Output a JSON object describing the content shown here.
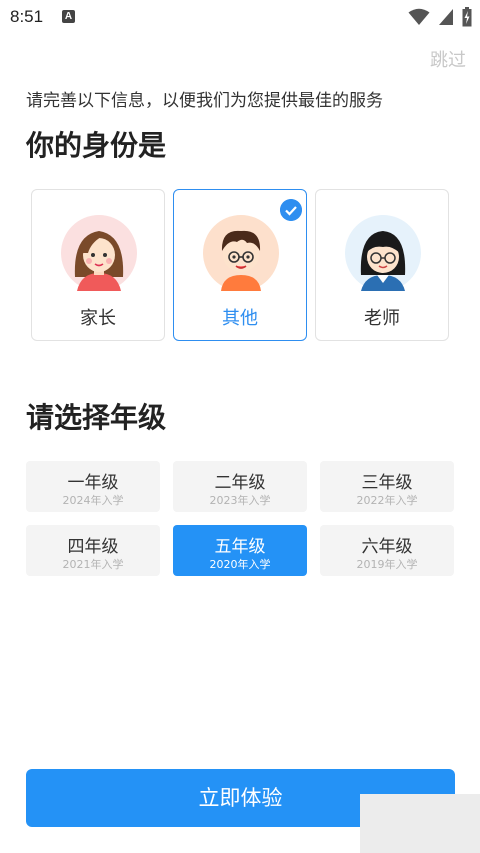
{
  "status_bar": {
    "time": "8:51",
    "notif_letter": "A"
  },
  "header": {
    "skip_label": "跳过"
  },
  "subtitle": "请完善以下信息，以便我们为您提供最佳的服务",
  "identity": {
    "title": "你的身份是",
    "roles": [
      {
        "label": "家长",
        "selected": false
      },
      {
        "label": "其他",
        "selected": true
      },
      {
        "label": "老师",
        "selected": false
      }
    ]
  },
  "grades": {
    "title": "请选择年级",
    "items": [
      {
        "name": "一年级",
        "year": "2024年入学",
        "selected": false
      },
      {
        "name": "二年级",
        "year": "2023年入学",
        "selected": false
      },
      {
        "name": "三年级",
        "year": "2022年入学",
        "selected": false
      },
      {
        "name": "四年级",
        "year": "2021年入学",
        "selected": false
      },
      {
        "name": "五年级",
        "year": "2020年入学",
        "selected": true
      },
      {
        "name": "六年级",
        "year": "2019年入学",
        "selected": false
      }
    ]
  },
  "cta_label": "立即体验",
  "colors": {
    "accent": "#2492f6",
    "selected_border": "#2e8ef0",
    "muted": "#c8c8c8"
  }
}
